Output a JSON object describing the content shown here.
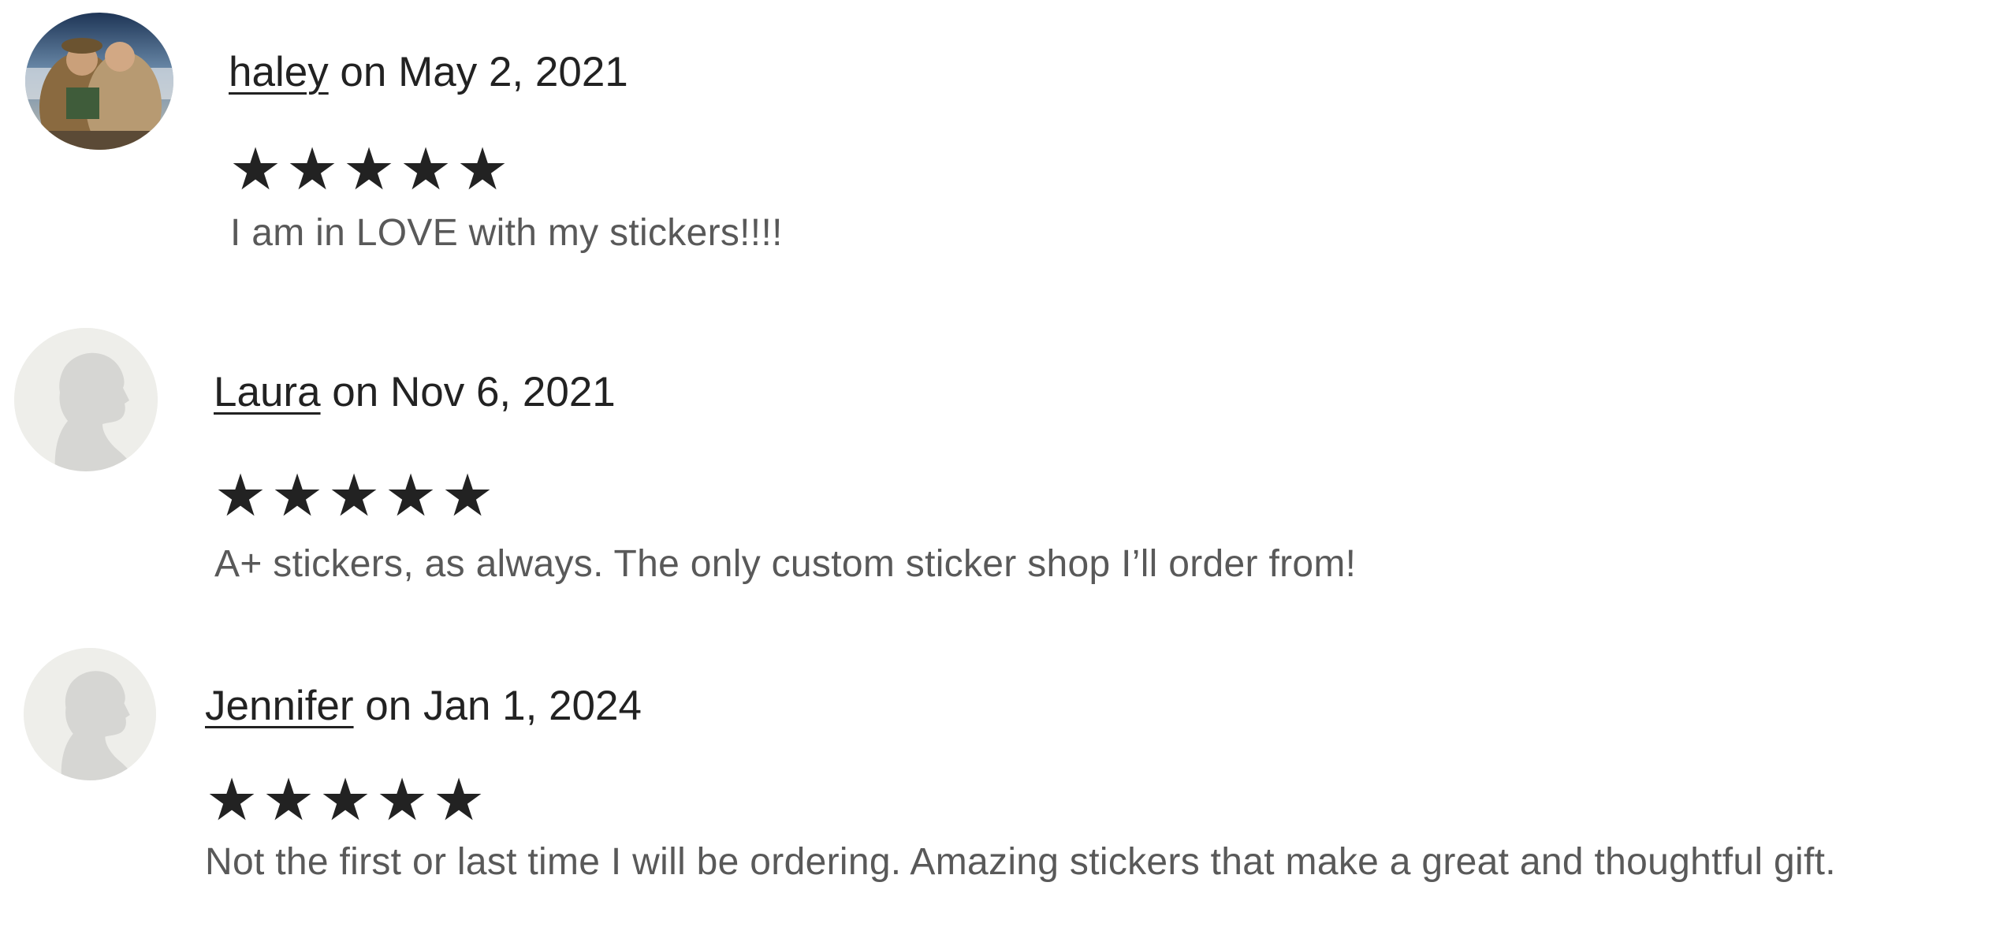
{
  "reviews": [
    {
      "name": "haley",
      "date_text": " on May 2, 2021",
      "rating": 5,
      "text": "I am in LOVE with my stickers!!!!",
      "avatar": "user-photo"
    },
    {
      "name": "Laura",
      "date_text": " on Nov 6, 2021",
      "rating": 5,
      "text": "A+ stickers, as always. The only custom sticker shop I’ll order from!",
      "avatar": "default-avatar-icon"
    },
    {
      "name": "Jennifer",
      "date_text": " on Jan 1, 2024",
      "rating": 5,
      "text": "Not the first or last time I will be ordering. Amazing stickers that make a great and thoughtful gift.",
      "avatar": "default-avatar-icon"
    }
  ],
  "star_glyph": "★",
  "colors": {
    "text_primary": "#222222",
    "text_secondary": "#595959",
    "avatar_bg": "#eeeeea",
    "avatar_silhouette": "#d6d6d3"
  }
}
